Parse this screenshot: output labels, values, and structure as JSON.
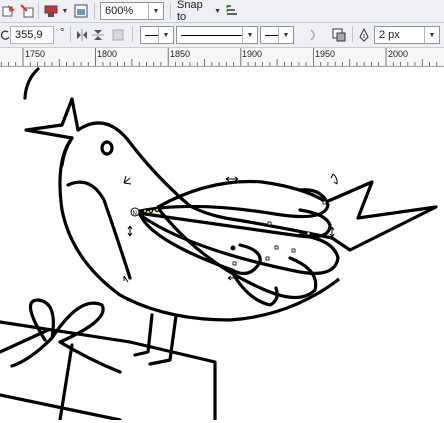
{
  "toolbar_top": {
    "zoom_value": "600%",
    "snap_label": "Snap to",
    "icons": [
      "import-icon",
      "export-icon",
      "publish-icon",
      "page-layout-icon",
      "snap-options-icon"
    ]
  },
  "toolbar_props": {
    "angle_value": "355,9",
    "angle_unit": "°",
    "outline_width_value": "2 px",
    "icons": [
      "rotate-icon",
      "mirror-h-icon",
      "mirror-v-icon",
      "wrap-icon",
      "line-start-icon",
      "line-end-icon",
      "close-curve-icon",
      "to-front-icon",
      "pen-icon"
    ]
  },
  "ruler": {
    "ticks": [
      "1750",
      "1800",
      "1850",
      "1900",
      "1950",
      "2000"
    ]
  },
  "colors": {
    "toolbar_bg": "#eef0f3",
    "ruler_bg": "#f7f7f7",
    "stroke": "#000000"
  }
}
